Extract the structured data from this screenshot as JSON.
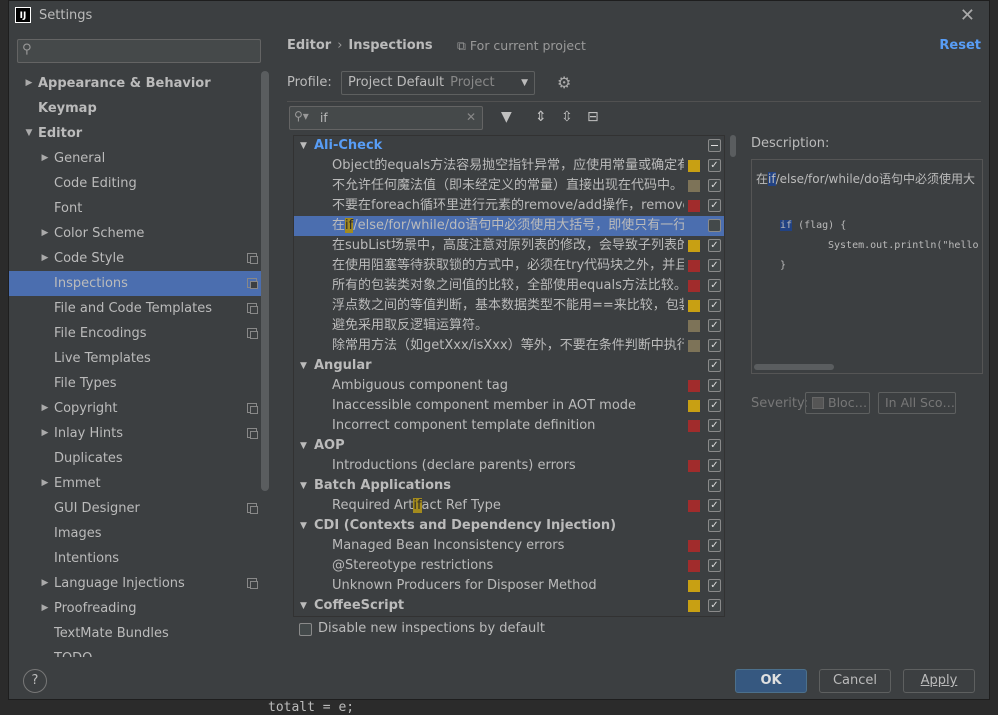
{
  "window": {
    "title": "Settings",
    "logo_text": "IJ"
  },
  "search": {
    "placeholder": "",
    "value": ""
  },
  "sidebar": {
    "items": [
      {
        "label": "Appearance & Behavior",
        "level": 0,
        "arrow": "right",
        "bold": true
      },
      {
        "label": "Keymap",
        "level": 0,
        "arrow": "",
        "bold": true
      },
      {
        "label": "Editor",
        "level": 0,
        "arrow": "down",
        "bold": true
      },
      {
        "label": "General",
        "level": 1,
        "arrow": "right"
      },
      {
        "label": "Code Editing",
        "level": 1,
        "arrow": ""
      },
      {
        "label": "Font",
        "level": 1,
        "arrow": ""
      },
      {
        "label": "Color Scheme",
        "level": 1,
        "arrow": "right"
      },
      {
        "label": "Code Style",
        "level": 1,
        "arrow": "right",
        "copy": true
      },
      {
        "label": "Inspections",
        "level": 1,
        "arrow": "",
        "copy": true,
        "selected": true
      },
      {
        "label": "File and Code Templates",
        "level": 1,
        "arrow": "",
        "copy": true
      },
      {
        "label": "File Encodings",
        "level": 1,
        "arrow": "",
        "copy": true
      },
      {
        "label": "Live Templates",
        "level": 1,
        "arrow": ""
      },
      {
        "label": "File Types",
        "level": 1,
        "arrow": ""
      },
      {
        "label": "Copyright",
        "level": 1,
        "arrow": "right",
        "copy": true
      },
      {
        "label": "Inlay Hints",
        "level": 1,
        "arrow": "right",
        "copy": true
      },
      {
        "label": "Duplicates",
        "level": 1,
        "arrow": ""
      },
      {
        "label": "Emmet",
        "level": 1,
        "arrow": "right"
      },
      {
        "label": "GUI Designer",
        "level": 1,
        "arrow": "",
        "copy": true
      },
      {
        "label": "Images",
        "level": 1,
        "arrow": ""
      },
      {
        "label": "Intentions",
        "level": 1,
        "arrow": ""
      },
      {
        "label": "Language Injections",
        "level": 1,
        "arrow": "right",
        "copy": true
      },
      {
        "label": "Proofreading",
        "level": 1,
        "arrow": "right"
      },
      {
        "label": "TextMate Bundles",
        "level": 1,
        "arrow": ""
      },
      {
        "label": "TODO",
        "level": 1,
        "arrow": ""
      }
    ]
  },
  "header": {
    "crumb1": "Editor",
    "crumb_sep": "›",
    "crumb2": "Inspections",
    "for_current": "For current project",
    "reset": "Reset"
  },
  "profile": {
    "label": "Profile:",
    "value": "Project Default",
    "sub": "Project"
  },
  "filter": {
    "value": "if"
  },
  "inspections": [
    {
      "type": "group",
      "label": "Ali-Check",
      "highlight": true,
      "check": "minus"
    },
    {
      "type": "item",
      "label": "Object的equals方法容易抛空指针异常，应使用常量或确定有值的",
      "sev": "#c8a013",
      "check": true
    },
    {
      "type": "item",
      "label": "不允许任何魔法值（即未经定义的常量）直接出现在代码中。",
      "sev": "#7d7358",
      "check": true
    },
    {
      "type": "item",
      "label": "不要在foreach循环里进行元素的remove/add操作，remove元素",
      "sev": "#a12c2c",
      "check": true
    },
    {
      "type": "item",
      "label_pre": "在",
      "label_hl": "if",
      "label_post": "/else/for/while/do语句中必须使用大括号，即使只有一行代码",
      "sev": "",
      "check": false,
      "selected": true
    },
    {
      "type": "item",
      "label": "在subList场景中，高度注意对原列表的修改，会导致子列表的遍历",
      "sev": "#c8a013",
      "check": true
    },
    {
      "type": "item",
      "label": "在使用阻塞等待获取锁的方式中，必须在try代码块之外，并且在加",
      "sev": "#a12c2c",
      "check": true
    },
    {
      "type": "item",
      "label": "所有的包装类对象之间值的比较，全部使用equals方法比较。",
      "sev": "#a12c2c",
      "check": true
    },
    {
      "type": "item",
      "label": "浮点数之间的等值判断，基本数据类型不能用==来比较，包装数据",
      "sev": "#c8a013",
      "check": true
    },
    {
      "type": "item",
      "label": "避免采用取反逻辑运算符。",
      "sev": "#7d7358",
      "check": true
    },
    {
      "type": "item",
      "label": "除常用方法（如getXxx/isXxx）等外，不要在条件判断中执行复杂",
      "sev": "#7d7358",
      "check": true
    },
    {
      "type": "group",
      "label": "Angular",
      "check": true
    },
    {
      "type": "item",
      "label": "Ambiguous component tag",
      "sev": "#a12c2c",
      "check": true
    },
    {
      "type": "item",
      "label": "Inaccessible component member in AOT mode",
      "sev": "#c8a013",
      "check": true
    },
    {
      "type": "item",
      "label": "Incorrect component template definition",
      "sev": "#a12c2c",
      "check": true
    },
    {
      "type": "group",
      "label": "AOP",
      "check": true
    },
    {
      "type": "item",
      "label": "Introductions (declare parents) errors",
      "sev": "#a12c2c",
      "check": true
    },
    {
      "type": "group",
      "label": "Batch Applications",
      "check": true
    },
    {
      "type": "item",
      "label_pre": "Required Art",
      "label_hl": "if",
      "label_post": "act Ref Type",
      "sev": "#a12c2c",
      "check": true
    },
    {
      "type": "group",
      "label": "CDI (Contexts and Dependency Injection)",
      "check": true
    },
    {
      "type": "item",
      "label": "Managed Bean Inconsistency errors",
      "sev": "#a12c2c",
      "check": true
    },
    {
      "type": "item",
      "label": "@Stereotype restrictions",
      "sev": "#a12c2c",
      "check": true
    },
    {
      "type": "item",
      "label": "Unknown Producers for Disposer Method",
      "sev": "#c8a013",
      "check": true
    },
    {
      "type": "group",
      "label": "CoffeeScript",
      "sev": "#c8a013",
      "check": true
    }
  ],
  "description": {
    "label": "Description:",
    "text_pre": "在",
    "text_hl": "if",
    "text_post": "/else/for/while/do语句中必须使用大",
    "code_kw": "if",
    "code_line1_post": " (flag) {",
    "code_line2": "System.out.println(\"hello",
    "code_line3": "}"
  },
  "severity": {
    "label": "Severity:",
    "value": "Bloc…",
    "scope": "In All Sco…"
  },
  "disable_new": {
    "label": "Disable new inspections by default"
  },
  "footer": {
    "help": "?",
    "ok": "OK",
    "cancel": "Cancel",
    "apply": "Apply"
  },
  "behind_code": "totalt = e;"
}
